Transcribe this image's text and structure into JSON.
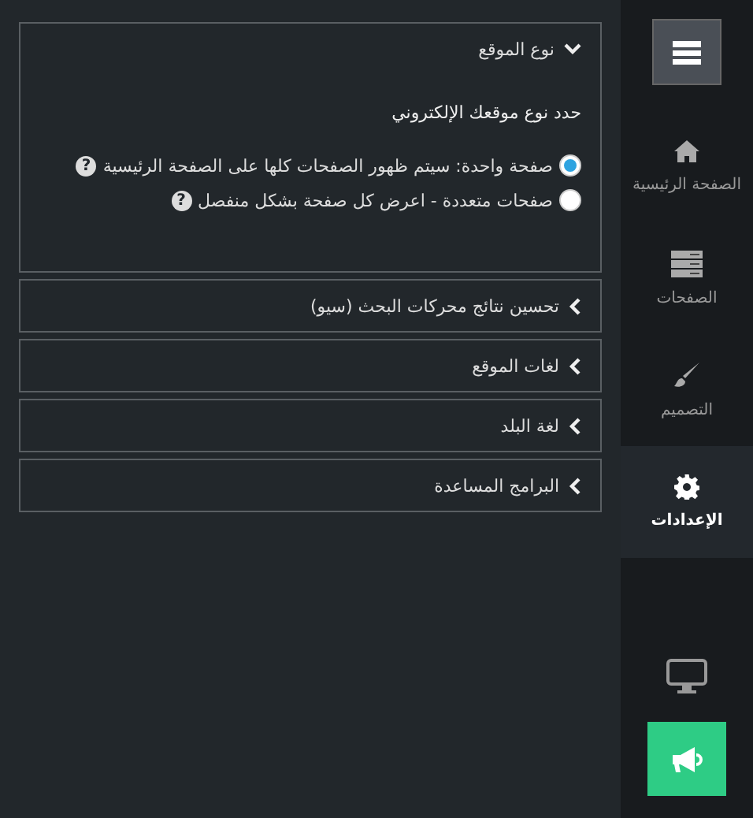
{
  "sections": [
    {
      "title": "نوع الموقع",
      "expanded": true,
      "prompt": "حدد نوع موقعك الإلكتروني",
      "options": [
        {
          "label": "صفحة واحدة: سيتم ظهور الصفحات كلها على الصفحة الرئيسية",
          "selected": true,
          "help": "?"
        },
        {
          "label": "صفحات متعددة - اعرض كل صفحة بشكل منفصل",
          "selected": false,
          "help": "?"
        }
      ]
    },
    {
      "title": "تحسين نتائج محركات البحث (سيو)",
      "expanded": false
    },
    {
      "title": "لغات الموقع",
      "expanded": false
    },
    {
      "title": "لغة البلد",
      "expanded": false
    },
    {
      "title": "البرامج المساعدة",
      "expanded": false
    }
  ],
  "sidebar": {
    "items": [
      {
        "kind": "home",
        "label": "الصفحة الرئيسية",
        "selected": false
      },
      {
        "kind": "pages",
        "label": "الصفحات",
        "selected": false
      },
      {
        "kind": "design",
        "label": "التصميم",
        "selected": false
      },
      {
        "kind": "settings",
        "label": "الإعدادات",
        "selected": true
      }
    ]
  }
}
